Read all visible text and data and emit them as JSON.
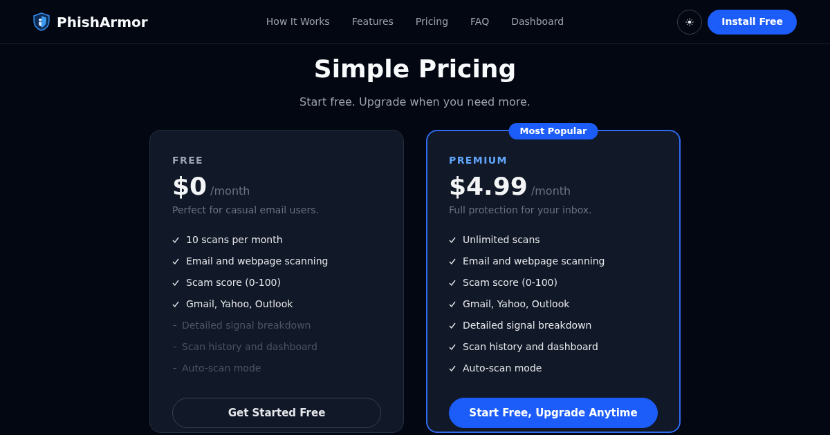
{
  "brand": {
    "name": "PhishArmor"
  },
  "nav": {
    "links": [
      "How It Works",
      "Features",
      "Pricing",
      "FAQ",
      "Dashboard"
    ],
    "cta": "Install Free"
  },
  "hero": {
    "title": "Simple Pricing",
    "subtitle": "Start free. Upgrade when you need more."
  },
  "plans": [
    {
      "name": "FREE",
      "featured": false,
      "price": "$0",
      "period": "/month",
      "description": "Perfect for casual email users.",
      "features": [
        {
          "text": "10 scans per month",
          "included": true
        },
        {
          "text": "Email and webpage scanning",
          "included": true
        },
        {
          "text": "Scam score (0-100)",
          "included": true
        },
        {
          "text": "Gmail, Yahoo, Outlook",
          "included": true
        },
        {
          "text": "Detailed signal breakdown",
          "included": false
        },
        {
          "text": "Scan history and dashboard",
          "included": false
        },
        {
          "text": "Auto-scan mode",
          "included": false
        }
      ],
      "button": "Get Started Free"
    },
    {
      "name": "PREMIUM",
      "featured": true,
      "badge": "Most Popular",
      "price": "$4.99",
      "period": "/month",
      "description": "Full protection for your inbox.",
      "features": [
        {
          "text": "Unlimited scans",
          "included": true
        },
        {
          "text": "Email and webpage scanning",
          "included": true
        },
        {
          "text": "Scam score (0-100)",
          "included": true
        },
        {
          "text": "Gmail, Yahoo, Outlook",
          "included": true
        },
        {
          "text": "Detailed signal breakdown",
          "included": true
        },
        {
          "text": "Scan history and dashboard",
          "included": true
        },
        {
          "text": "Auto-scan mode",
          "included": true
        }
      ],
      "button": "Start Free, Upgrade Anytime"
    }
  ]
}
